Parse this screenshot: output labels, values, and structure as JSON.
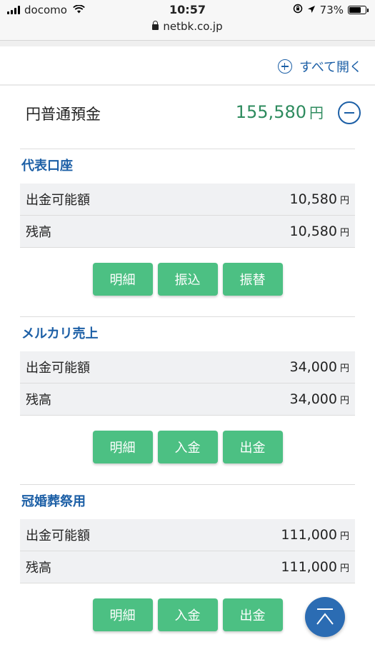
{
  "status_bar": {
    "carrier": "docomo",
    "time": "10:57",
    "battery": "73%",
    "battery_level": 0.73,
    "url": "netbk.co.jp",
    "icons": [
      "signal-icon",
      "wifi-icon",
      "location-icon",
      "battery-icon",
      "lock-icon"
    ]
  },
  "expand_all": {
    "label": "すべて開く",
    "icon": "plus-circle-icon"
  },
  "account": {
    "title": "円普通預金",
    "total": "155,580",
    "currency": "円",
    "collapse_icon": "minus-circle-icon"
  },
  "sections": [
    {
      "title": "代表口座",
      "rows": [
        {
          "label": "出金可能額",
          "value": "10,580",
          "unit": "円"
        },
        {
          "label": "残高",
          "value": "10,580",
          "unit": "円"
        }
      ],
      "buttons": [
        "明細",
        "振込",
        "振替"
      ]
    },
    {
      "title": "メルカリ売上",
      "rows": [
        {
          "label": "出金可能額",
          "value": "34,000",
          "unit": "円"
        },
        {
          "label": "残高",
          "value": "34,000",
          "unit": "円"
        }
      ],
      "buttons": [
        "明細",
        "入金",
        "出金"
      ]
    },
    {
      "title": "冠婚葬祭用",
      "rows": [
        {
          "label": "出金可能額",
          "value": "111,000",
          "unit": "円"
        },
        {
          "label": "残高",
          "value": "111,000",
          "unit": "円"
        }
      ],
      "buttons": [
        "明細",
        "入金",
        "出金"
      ]
    }
  ],
  "colors": {
    "accent_blue": "#1c5fa6",
    "amount_green": "#2e8b5e",
    "button_green": "#4cc083",
    "row_bg": "#f0f1f3"
  },
  "fab": {
    "icon": "scroll-to-top-icon"
  }
}
